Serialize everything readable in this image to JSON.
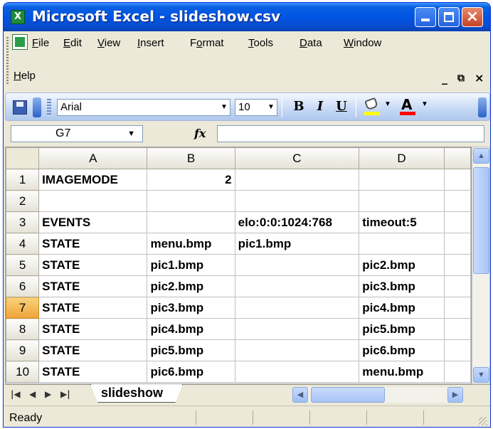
{
  "window": {
    "title": "Microsoft Excel - slideshow.csv"
  },
  "menu": {
    "items": [
      {
        "label": "File",
        "u": "F",
        "rest": "ile"
      },
      {
        "label": "Edit",
        "u": "E",
        "rest": "dit"
      },
      {
        "label": "View",
        "u": "V",
        "rest": "iew"
      },
      {
        "label": "Insert",
        "u": "I",
        "rest": "nsert"
      },
      {
        "label": "Format",
        "pre": "F",
        "u": "o",
        "rest": "rmat"
      },
      {
        "label": "Tools",
        "u": "T",
        "rest": "ools"
      },
      {
        "label": "Data",
        "u": "D",
        "rest": "ata"
      },
      {
        "label": "Window",
        "u": "W",
        "rest": "indow"
      },
      {
        "label": "Help",
        "u": "H",
        "rest": "elp"
      }
    ]
  },
  "toolbar": {
    "font_name": "Arial",
    "font_size": "10",
    "bold": "B",
    "italic": "I",
    "underline": "U",
    "font_color_glyph": "A",
    "fill_color": "#ffff00",
    "font_color": "#ff0000"
  },
  "formula_bar": {
    "name_box": "G7",
    "fx_label": "fx",
    "value": ""
  },
  "sheet": {
    "columns": [
      "A",
      "B",
      "C",
      "D"
    ],
    "selected_row": "7",
    "rows": [
      {
        "n": "1",
        "cells": [
          "IMAGEMODE",
          "2",
          "",
          ""
        ]
      },
      {
        "n": "2",
        "cells": [
          "",
          "",
          "",
          ""
        ]
      },
      {
        "n": "3",
        "cells": [
          "EVENTS",
          "",
          "elo:0:0:1024:768",
          "timeout:5"
        ]
      },
      {
        "n": "4",
        "cells": [
          "STATE",
          "menu.bmp",
          "pic1.bmp",
          ""
        ]
      },
      {
        "n": "5",
        "cells": [
          "STATE",
          "pic1.bmp",
          "",
          "pic2.bmp"
        ]
      },
      {
        "n": "6",
        "cells": [
          "STATE",
          "pic2.bmp",
          "",
          "pic3.bmp"
        ]
      },
      {
        "n": "7",
        "cells": [
          "STATE",
          "pic3.bmp",
          "",
          "pic4.bmp"
        ]
      },
      {
        "n": "8",
        "cells": [
          "STATE",
          "pic4.bmp",
          "",
          "pic5.bmp"
        ]
      },
      {
        "n": "9",
        "cells": [
          "STATE",
          "pic5.bmp",
          "",
          "pic6.bmp"
        ]
      },
      {
        "n": "10",
        "cells": [
          "STATE",
          "pic6.bmp",
          "",
          "menu.bmp"
        ]
      }
    ]
  },
  "tabs": {
    "active": "slideshow"
  },
  "status": {
    "text": "Ready"
  }
}
